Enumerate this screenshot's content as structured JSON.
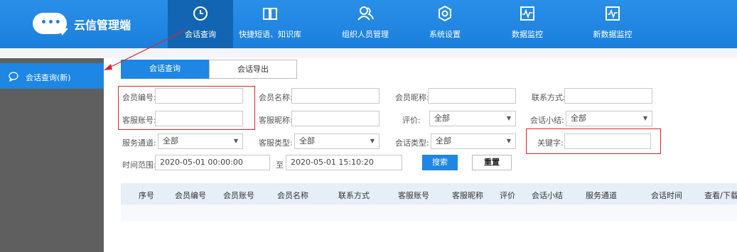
{
  "app": {
    "title": "云信管理端",
    "logo_dots": "•••"
  },
  "nav": [
    {
      "label": "会话查询",
      "icon": "clock-icon",
      "active": true
    },
    {
      "label": "快捷短语、知识库",
      "icon": "book-icon"
    },
    {
      "label": "组织人员管理",
      "icon": "users-icon"
    },
    {
      "label": "系统设置",
      "icon": "gear-icon"
    },
    {
      "label": "数据监控",
      "icon": "monitor-icon"
    },
    {
      "label": "新数据监控",
      "icon": "monitor-icon"
    }
  ],
  "sidebar": {
    "items": [
      {
        "label": "会话查询(新)",
        "icon": "chat-icon",
        "active": true
      }
    ]
  },
  "tabs": [
    {
      "label": "会话查询",
      "active": true
    },
    {
      "label": "会话导出"
    }
  ],
  "form": {
    "member_id": {
      "label": "会员编号:",
      "value": ""
    },
    "member_name": {
      "label": "会员名称:",
      "value": ""
    },
    "member_nick": {
      "label": "会员昵称:",
      "value": ""
    },
    "contact": {
      "label": "联系方式:",
      "value": ""
    },
    "agent_account": {
      "label": "客服账号:",
      "value": ""
    },
    "agent_nick": {
      "label": "客服昵称:",
      "value": ""
    },
    "rating": {
      "label": "评价:",
      "value": "全部"
    },
    "summary": {
      "label": "会话小结:",
      "value": "全部"
    },
    "channel": {
      "label": "服务通道:",
      "value": "全部"
    },
    "agent_type": {
      "label": "客服类型:",
      "value": "全部"
    },
    "session_type": {
      "label": "会话类型:",
      "value": "全部"
    },
    "keyword": {
      "label": "关键字:",
      "value": ""
    },
    "time": {
      "label": "时间范围:",
      "start": "2020-05-01 00:00:00",
      "sep": "至",
      "end": "2020-05-01 15:10:20"
    },
    "search_label": "搜索",
    "reset_label": "重置"
  },
  "table": {
    "columns": [
      "序号",
      "会员编号",
      "会员账号",
      "会员名称",
      "联系方式",
      "客服账号",
      "客服昵称",
      "评价",
      "会话小结",
      "服务通道",
      "会话时间",
      "查看/下载"
    ]
  },
  "colors": {
    "primary": "#1e86e3",
    "nav_active": "#1265b3",
    "highlight": "#d9262b",
    "sidebar_bg": "#5f5f5f"
  }
}
